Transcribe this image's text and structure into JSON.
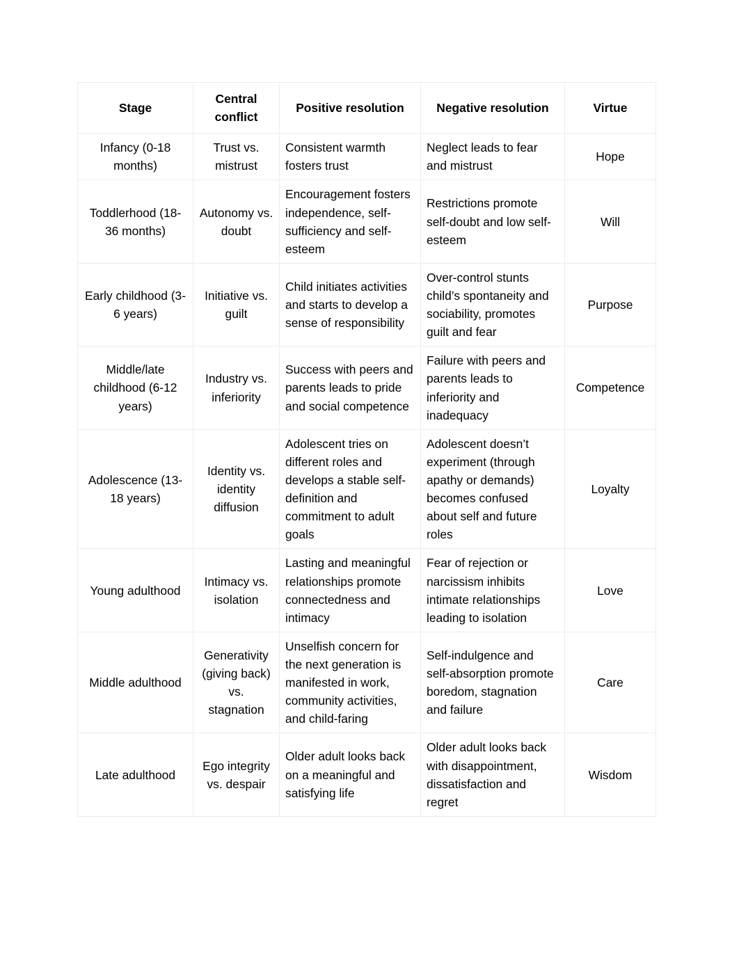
{
  "document": {
    "table": {
      "caption": "",
      "columns": [
        "Stage",
        "Central conflict",
        "Positive resolution",
        "Negative resolution",
        "Virtue"
      ],
      "rows": [
        {
          "stage": "Infancy (0-18 months)",
          "conflict": "Trust vs. mistrust",
          "positive": "Consistent warmth fosters trust",
          "negative": "Neglect leads to fear and mistrust",
          "virtue": "Hope"
        },
        {
          "stage": "Toddlerhood (18-36 months)",
          "conflict": "Autonomy vs. doubt",
          "positive": "Encouragement fosters independence, self-sufficiency and self-esteem",
          "negative": "Restrictions promote self-doubt and low self-esteem",
          "virtue": "Will"
        },
        {
          "stage": "Early childhood (3-6 years)",
          "conflict": "Initiative vs. guilt",
          "positive": "Child initiates activities and starts to develop a sense of responsibility",
          "negative": "Over-control stunts child’s spontaneity and sociability, promotes guilt and fear",
          "virtue": "Purpose"
        },
        {
          "stage": "Middle/late childhood (6-12 years)",
          "conflict": "Industry vs. inferiority",
          "positive": "Success with peers and parents leads to pride and social competence",
          "negative": "Failure with peers and parents leads to inferiority and inadequacy",
          "virtue": "Competence"
        },
        {
          "stage": "Adolescence (13-18 years)",
          "conflict": "Identity vs. identity diffusion",
          "positive": "Adolescent tries on different roles and develops a stable self-definition and commitment to adult goals",
          "negative": "Adolescent doesn’t experiment (through apathy or demands) becomes confused about self and future roles",
          "virtue": "Loyalty"
        },
        {
          "stage": "Young adulthood",
          "conflict": "Intimacy vs. isolation",
          "positive": "Lasting and meaningful relationships promote connectedness and intimacy",
          "negative": "Fear of rejection or narcissism inhibits intimate relationships leading to isolation",
          "virtue": "Love"
        },
        {
          "stage": "Middle adulthood",
          "conflict": "Generativity (giving back) vs. stagnation",
          "positive": "Unselfish concern for the next generation is manifested in work, community activities, and child-faring",
          "negative": "Self-indulgence and self-absorption promote boredom, stagnation and failure",
          "virtue": "Care"
        },
        {
          "stage": "Late adulthood",
          "conflict": "Ego integrity vs. despair",
          "positive": "Older adult looks back on a meaningful and satisfying life",
          "negative": "Older adult looks back with disappointment, dissatisfaction and regret",
          "virtue": "Wisdom"
        }
      ]
    }
  }
}
